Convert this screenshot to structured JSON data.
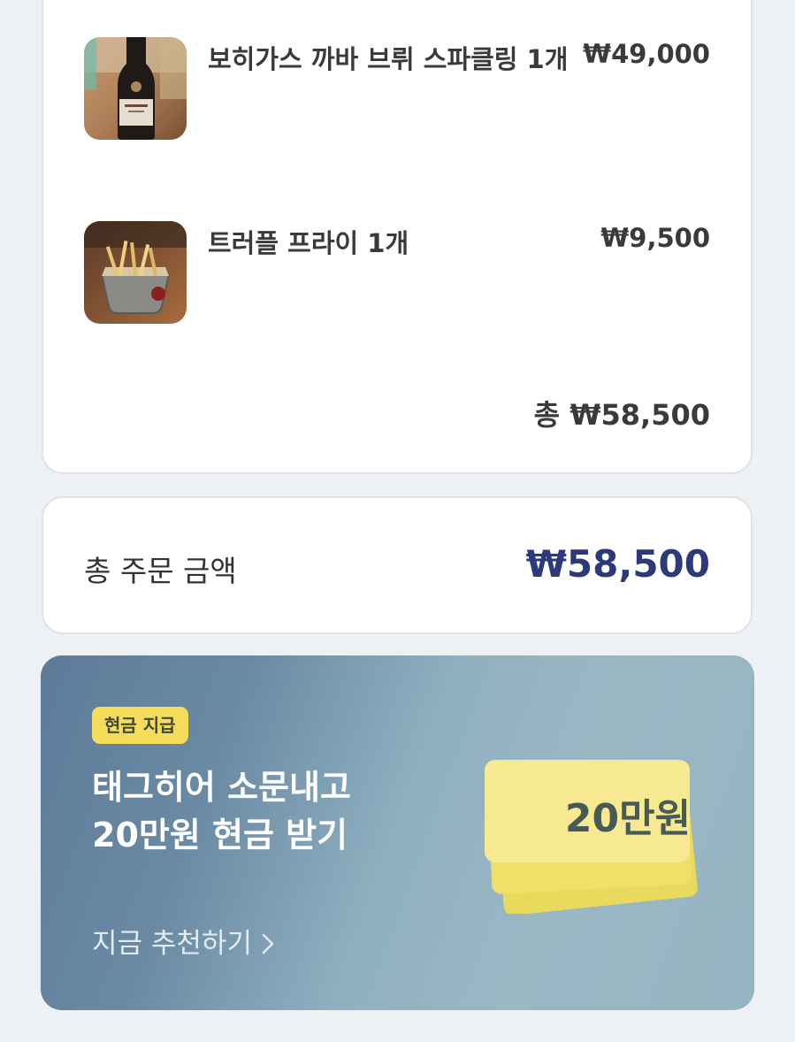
{
  "order": {
    "items": [
      {
        "name": "보히가스 까바 브뤼 스파클링 1개",
        "price": "₩49,000",
        "image": "sparkling-wine-bottle"
      },
      {
        "name": "트러플 프라이 1개",
        "price": "₩9,500",
        "image": "truffle-fries-basket"
      }
    ],
    "subtotal": "총 ₩58,500"
  },
  "summary": {
    "label": "총 주문 금액",
    "amount": "₩58,500"
  },
  "promo": {
    "badge": "현금 지급",
    "title_line1": "태그히어 소문내고",
    "title_line2": "20만원 현금 받기",
    "cta": "지금 추천하기",
    "cta_icon": "chevron-right-icon",
    "ticket_amount": "20만원",
    "colors": {
      "badge_bg": "#f5dc5a",
      "ticket_bg": "#f2e166",
      "accent_amount": "#2d3a7a"
    }
  }
}
